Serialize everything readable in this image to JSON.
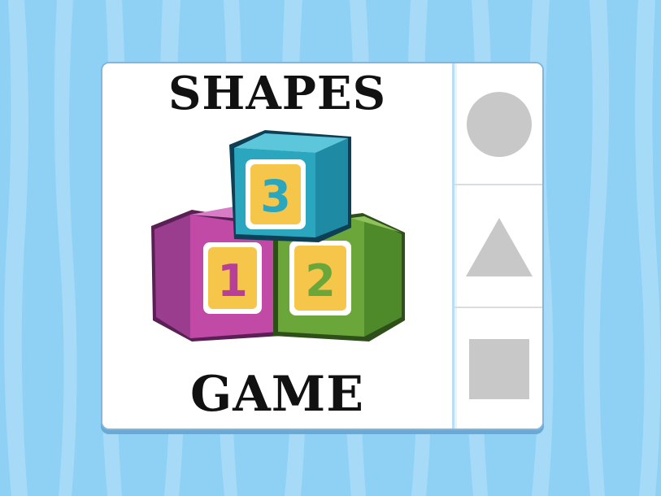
{
  "title_top": "SHAPES",
  "title_bottom": "GAME",
  "blocks": [
    {
      "number": "3",
      "color": "#2aa6bf"
    },
    {
      "number": "1",
      "color": "#b83e9b"
    },
    {
      "number": "2",
      "color": "#6aa63a"
    }
  ],
  "shape_options": [
    "circle-icon",
    "triangle-icon",
    "square-icon"
  ],
  "colors": {
    "background": "#8fd0f5",
    "shape_gray": "#c8c8c8",
    "block_face": "#f6c64a"
  }
}
